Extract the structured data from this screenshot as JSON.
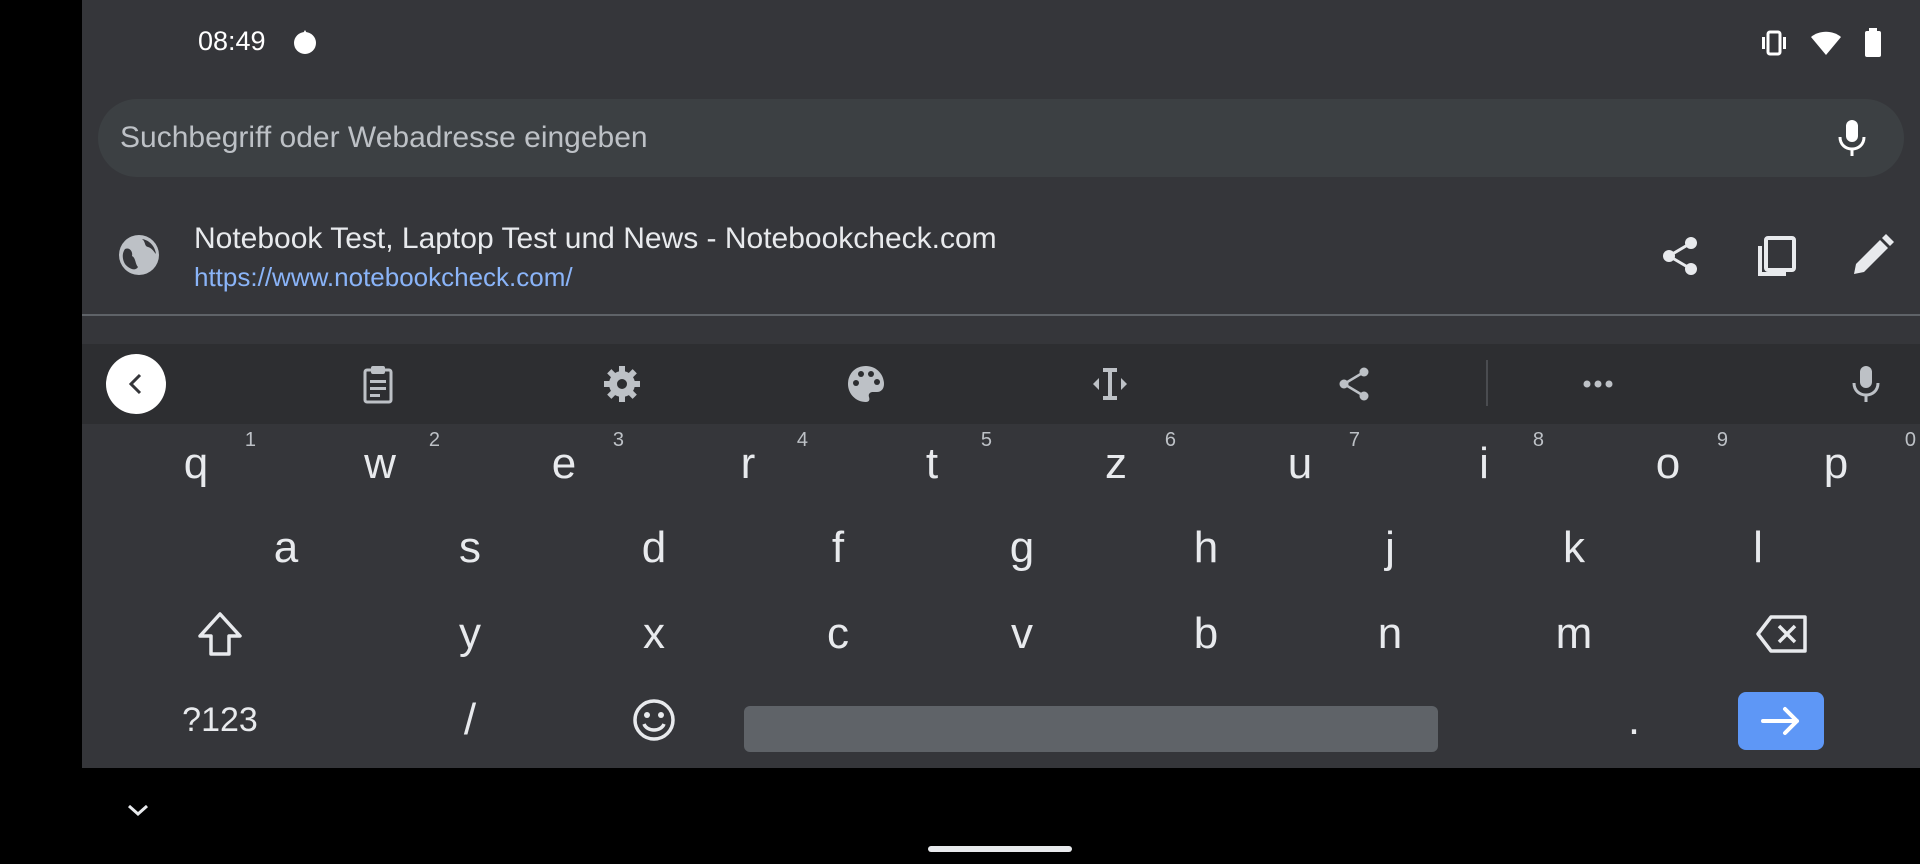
{
  "status_bar": {
    "time": "08:49",
    "icons": [
      "app-notification-icon",
      "vibrate-icon",
      "wifi-icon",
      "battery-icon"
    ]
  },
  "omnibox": {
    "placeholder": "Suchbegriff oder Webadresse eingeben",
    "value": "",
    "mic_icon": "microphone-icon"
  },
  "suggestion": {
    "title": "Notebook Test, Laptop Test und News - Notebookcheck.com",
    "url": "https://www.notebookcheck.com/",
    "actions": [
      "share-icon",
      "copy-icon",
      "edit-icon"
    ]
  },
  "keyboard": {
    "toolbar": [
      "back-icon",
      "clipboard-icon",
      "settings-icon",
      "theme-icon",
      "text-cursor-icon",
      "share-icon",
      "more-icon",
      "microphone-icon"
    ],
    "row1": [
      {
        "k": "q",
        "h": "1"
      },
      {
        "k": "w",
        "h": "2"
      },
      {
        "k": "e",
        "h": "3"
      },
      {
        "k": "r",
        "h": "4"
      },
      {
        "k": "t",
        "h": "5"
      },
      {
        "k": "z",
        "h": "6"
      },
      {
        "k": "u",
        "h": "7"
      },
      {
        "k": "i",
        "h": "8"
      },
      {
        "k": "o",
        "h": "9"
      },
      {
        "k": "p",
        "h": "0"
      }
    ],
    "row2": [
      "a",
      "s",
      "d",
      "f",
      "g",
      "h",
      "j",
      "k",
      "l"
    ],
    "row3": [
      "y",
      "x",
      "c",
      "v",
      "b",
      "n",
      "m"
    ],
    "symbols_label": "?123",
    "slash_label": "/",
    "period_label": ".",
    "accent_color": "#5e97f6"
  },
  "colors": {
    "background": "#35363a",
    "omnibox": "#3c4043",
    "link": "#8ab4f8",
    "keyboard_toolbar": "#2d2e31"
  }
}
